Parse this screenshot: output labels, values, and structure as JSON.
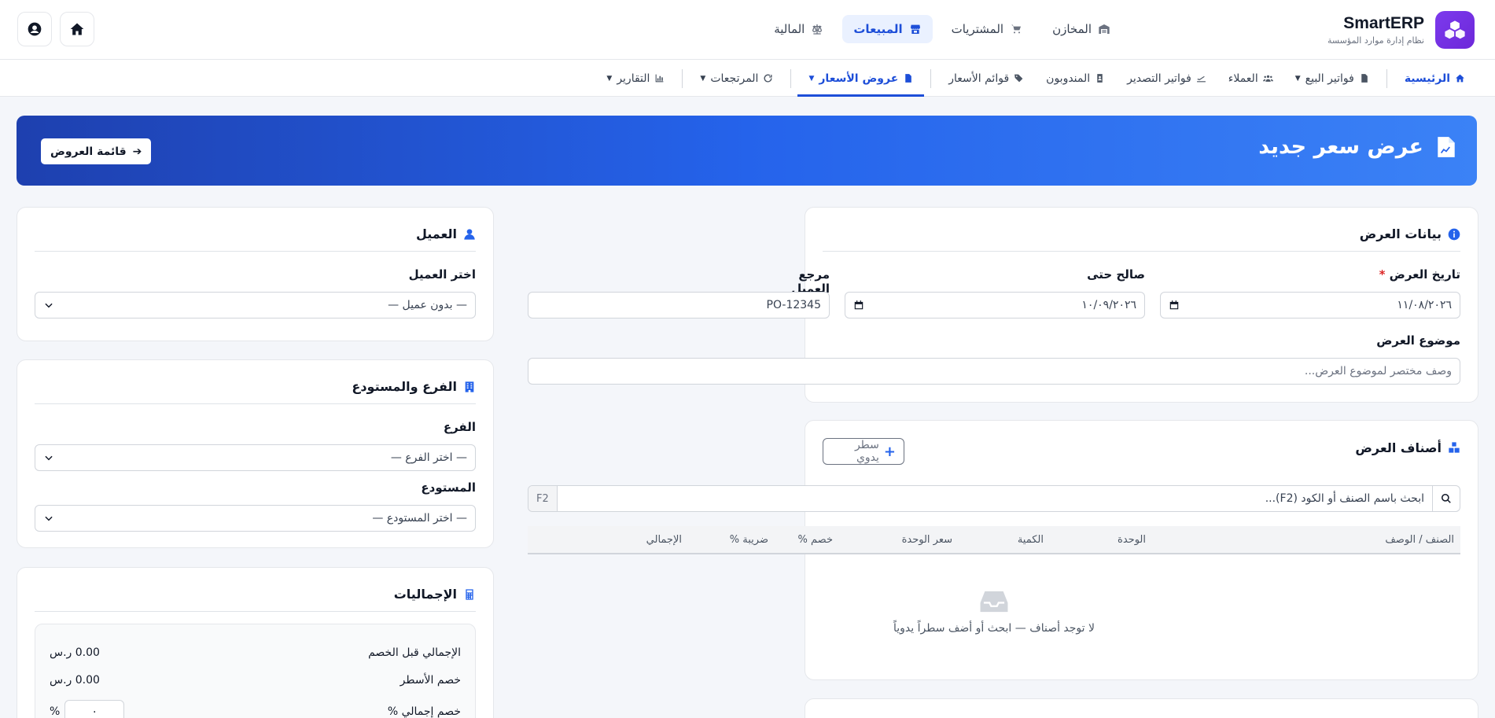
{
  "brand": {
    "name": "SmartERP",
    "subtitle": "نظام إدارة موارد المؤسسة"
  },
  "main_nav": [
    {
      "label": "المخازن",
      "icon": "warehouse-icon"
    },
    {
      "label": "المشتريات",
      "icon": "cart-icon"
    },
    {
      "label": "المبيعات",
      "icon": "store-icon",
      "active": true
    },
    {
      "label": "المالية",
      "icon": "scale-icon"
    }
  ],
  "sub_nav": {
    "home": "الرئيسية",
    "items": [
      {
        "label": "فواتير البيع",
        "caret": true
      },
      {
        "label": "العملاء"
      },
      {
        "label": "فواتير التصدير"
      },
      {
        "label": "المندوبون"
      },
      {
        "label": "قوائم الأسعار"
      },
      {
        "label": "عروض الأسعار",
        "caret": true,
        "active": true
      },
      {
        "label": "المرتجعات",
        "caret": true
      },
      {
        "label": "التقارير",
        "caret": true
      }
    ]
  },
  "hero": {
    "title": "عرض سعر جديد",
    "back_button": "قائمة العروض"
  },
  "offer_card": {
    "title": "بيانات العرض",
    "date_label": "تاريخ العرض",
    "required_mark": "*",
    "date_value": "١١/٠٨/٢٠٢٦",
    "valid_label": "صالح حتى",
    "valid_value": "١٠/٠٩/٢٠٢٦",
    "ref_label": "مرجع العميل",
    "ref_value": "PO-12345",
    "subject_label": "موضوع العرض",
    "subject_placeholder": "وصف مختصر لموضوع العرض..."
  },
  "items_card": {
    "title": "أصناف العرض",
    "manual_button": "سطر يدوي",
    "search_placeholder": "ابحث باسم الصنف أو الكود (F2)...",
    "shortcut": "F2",
    "columns": [
      "الصنف / الوصف",
      "الوحدة",
      "الكمية",
      "سعر الوحدة",
      "خصم %",
      "ضريبة %",
      "الإجمالي"
    ],
    "empty_text": "لا توجد أصناف — ابحث أو أضف سطراً يدوياً"
  },
  "customer_card": {
    "title": "العميل",
    "select_label": "اختر العميل",
    "select_value": "— بدون عميل —"
  },
  "branch_card": {
    "title": "الفرع والمستودع",
    "branch_label": "الفرع",
    "branch_value": "— اختر الفرع —",
    "warehouse_label": "المستودع",
    "warehouse_value": "— اختر المستودع —"
  },
  "totals_card": {
    "title": "الإجماليات",
    "rows": [
      {
        "label": "الإجمالي قبل الخصم",
        "value": "0.00 ر.س"
      },
      {
        "label": "خصم الأسطر",
        "value": "0.00 ر.س"
      }
    ],
    "discount_label": "خصم إجمالي %",
    "discount_value": "٠",
    "percent_sign": "%"
  },
  "colors": {
    "accent": "#1d4ed8",
    "hero_start": "#1e40af",
    "hero_end": "#3b82f6",
    "brand": "#7c3aed"
  }
}
